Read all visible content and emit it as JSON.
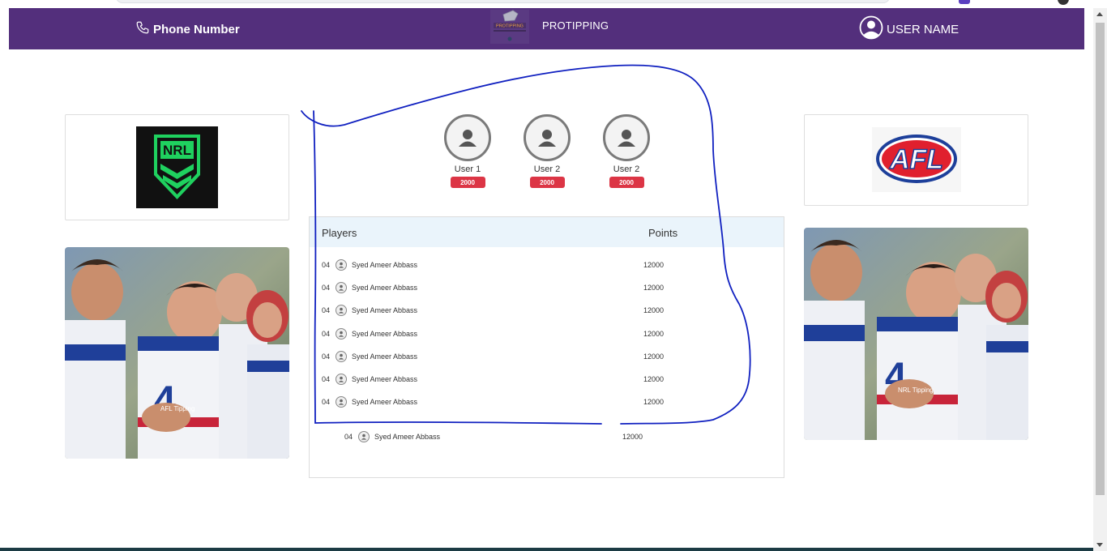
{
  "header": {
    "phone_label": "Phone Number",
    "brand_name": "PROTIPPING",
    "logo_text": "PROTIPPING",
    "user_label": "USER NAME"
  },
  "left_panel": {
    "logo_text": "NRL",
    "photo_caption": "AFL Tipping"
  },
  "right_panel": {
    "logo_text": "AFL",
    "photo_caption": "NRL Tipping"
  },
  "top_users": [
    {
      "name": "User 1",
      "score": "2000"
    },
    {
      "name": "User 2",
      "score": "2000"
    },
    {
      "name": "User 2",
      "score": "2000"
    }
  ],
  "leaderboard": {
    "col_players": "Players",
    "col_points": "Points",
    "rows": [
      {
        "rank": "04",
        "name": "Syed Ameer Abbass",
        "points": "12000"
      },
      {
        "rank": "04",
        "name": "Syed Ameer Abbass",
        "points": "12000"
      },
      {
        "rank": "04",
        "name": "Syed Ameer Abbass",
        "points": "12000"
      },
      {
        "rank": "04",
        "name": "Syed Ameer Abbass",
        "points": "12000"
      },
      {
        "rank": "04",
        "name": "Syed Ameer Abbass",
        "points": "12000"
      },
      {
        "rank": "04",
        "name": "Syed Ameer Abbass",
        "points": "12000"
      },
      {
        "rank": "04",
        "name": "Syed Ameer Abbass",
        "points": "12000"
      }
    ],
    "extra_row": {
      "rank": "04",
      "name": "Syed Ameer Abbass",
      "points": "12000"
    }
  },
  "colors": {
    "navbar": "#532f7c",
    "badge": "#dc3545",
    "table_header": "#eaf4fb",
    "annotation_ink": "#1020c0",
    "nrl_green": "#1fd15f",
    "afl_red": "#e0202e",
    "afl_blue": "#1d3f9a"
  }
}
